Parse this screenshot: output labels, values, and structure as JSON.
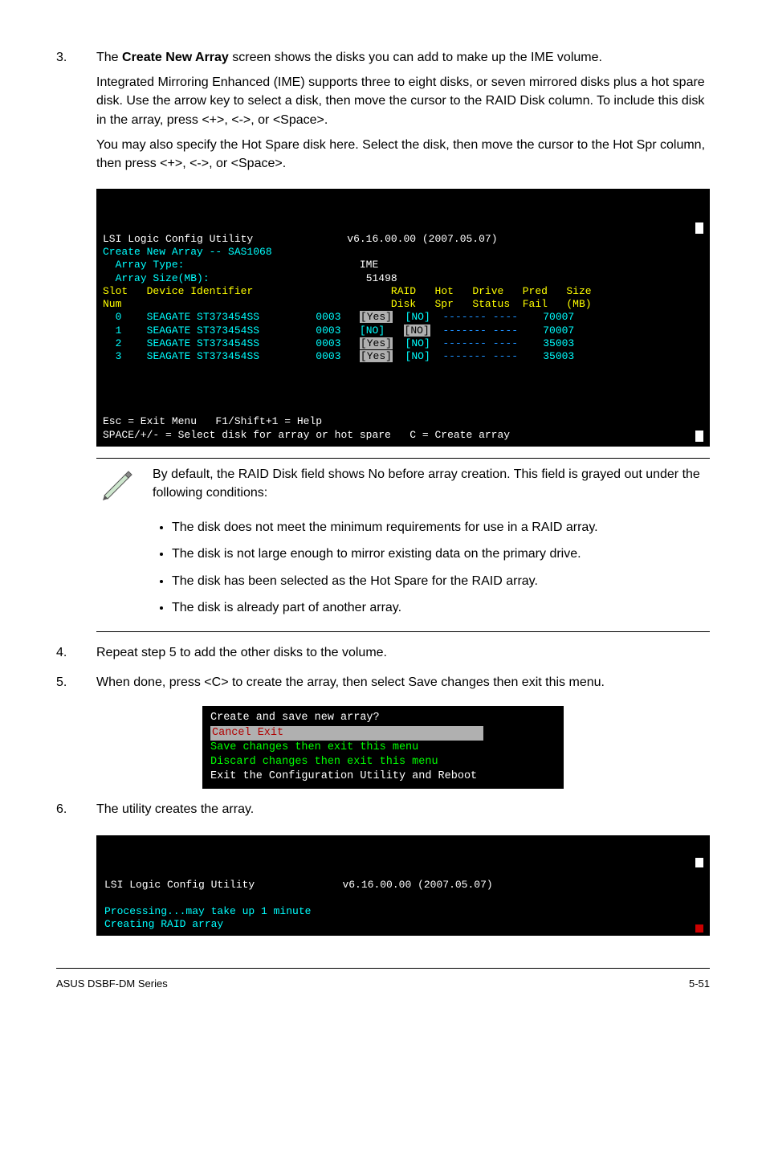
{
  "step3": {
    "num": "3.",
    "p1a": "The ",
    "p1b": "Create New Array",
    "p1c": " screen shows the disks you can add to make up the IME volume.",
    "p2": "Integrated Mirroring Enhanced (IME) supports three to eight disks, or seven mirrored disks plus a hot spare disk. Use the arrow key to select a disk, then move the cursor to the RAID Disk column. To include this disk in the array, press <+>, <->, or <Space>.",
    "p3": "You may also specify the Hot Spare disk here. Select the disk, then move the cursor to the Hot Spr column, then press <+>, <->, or <Space>."
  },
  "term1": {
    "title": "LSI Logic Config Utility",
    "version": "v6.16.00.00 (2007.05.07)",
    "sub": "Create New Array -- SAS1068",
    "row_at_label": "Array Type:",
    "row_at_val": "IME",
    "row_as_label": "Array Size(MB):",
    "row_as_val": "51498",
    "hdr_slot": "Slot",
    "hdr_num": "Num",
    "hdr_dev": "Device Identifier",
    "hdr_raid": "RAID",
    "hdr_disk": "Disk",
    "hdr_hot": "Hot",
    "hdr_spr": "Spr",
    "hdr_drive": "Drive",
    "hdr_status": "Status",
    "hdr_pred": "Pred",
    "hdr_fail": "Fail",
    "hdr_size": "Size",
    "hdr_mb": "(MB)",
    "rows": {
      "r0_slot": " 0",
      "r0_dev": "SEAGATE ST373454SS",
      "r0_id": "0003",
      "r0_raid": "[Yes]",
      "r0_hot": "[NO]",
      "r0_drv": "-------",
      "r0_pred": "----",
      "r0_size": "  70007",
      "r1_slot": " 1",
      "r1_dev": "SEAGATE ST373454SS",
      "r1_id": "0003",
      "r1_raid": "[NO]",
      "r1_hot": "[NO]",
      "r1_drv": "-------",
      "r1_pred": "----",
      "r1_size": "  70007",
      "r2_slot": " 2",
      "r2_dev": "SEAGATE ST373454SS",
      "r2_id": "0003",
      "r2_raid": "[Yes]",
      "r2_hot": "[NO]",
      "r2_drv": "-------",
      "r2_pred": "----",
      "r2_size": "  35003",
      "r3_slot": " 3",
      "r3_dev": "SEAGATE ST373454SS",
      "r3_id": "0003",
      "r3_raid": "[Yes]",
      "r3_hot": "[NO]",
      "r3_drv": "-------",
      "r3_pred": "----",
      "r3_size": "  35003"
    },
    "foot1": "Esc = Exit Menu   F1/Shift+1 = Help",
    "foot2": "SPACE/+/- = Select disk for array or hot spare   C = Create array"
  },
  "note": {
    "intro": "By default, the RAID Disk field shows No before array creation. This field is grayed out under the following conditions:",
    "b1": "The disk does not meet the  minimum requirements for use in a RAID array.",
    "b2": "The disk is not large enough to mirror existing data on the primary drive.",
    "b3": "The disk has been selected as the Hot Spare for the RAID array.",
    "b4": "The disk is already part of another array."
  },
  "step4": {
    "num": "4.",
    "p1": "Repeat step 5 to add the other disks to the volume."
  },
  "step5": {
    "num": "5.",
    "p1": "When done, press <C> to create the array, then select Save changes then exit this menu."
  },
  "menu": {
    "l1": "Create and save new array?",
    "l2": " Cancel Exit",
    "l3": " Save changes then exit this menu",
    "l4": " Discard changes then exit this menu",
    "l5": "Exit the Configuration Utility and Reboot"
  },
  "step6": {
    "num": "6.",
    "p1": "The utility creates the array."
  },
  "term2": {
    "title": "LSI Logic Config Utility",
    "version": "v6.16.00.00 (2007.05.07)",
    "l1": "Processing...may take up 1 minute",
    "l2": "Creating RAID array"
  },
  "footer": {
    "left": "ASUS DSBF-DM Series",
    "right": "5-51"
  }
}
